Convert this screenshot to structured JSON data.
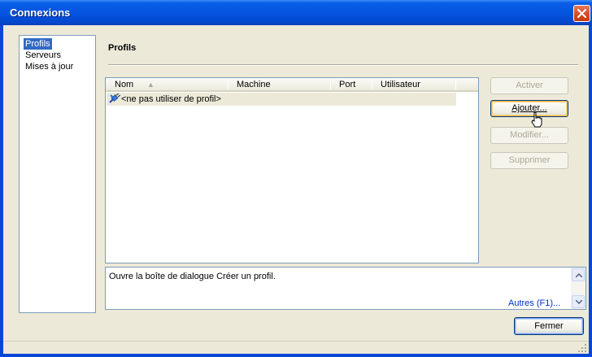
{
  "window": {
    "title": "Connexions"
  },
  "nav": {
    "items": [
      {
        "label": "Profils",
        "selected": true
      },
      {
        "label": "Serveurs",
        "selected": false
      },
      {
        "label": "Mises à jour",
        "selected": false
      }
    ]
  },
  "section": {
    "title": "Profils"
  },
  "table": {
    "columns": [
      "Nom",
      "Machine",
      "Port",
      "Utilisateur"
    ],
    "rows": [
      {
        "name": "<ne pas utiliser de profil>",
        "machine": "",
        "port": "",
        "user": "",
        "icon": "connection-plug-icon"
      }
    ]
  },
  "buttons": {
    "activate": "Activer",
    "add": "Ajouter...",
    "edit": "Modifier...",
    "delete": "Supprimer",
    "close": "Fermer"
  },
  "description": {
    "text": "Ouvre la boîte de dialogue Créer un profil.",
    "help_link": "Autres (F1)..."
  },
  "colors": {
    "title_bar": "#0554e0",
    "selection": "#316ac5",
    "link": "#0033cc"
  }
}
